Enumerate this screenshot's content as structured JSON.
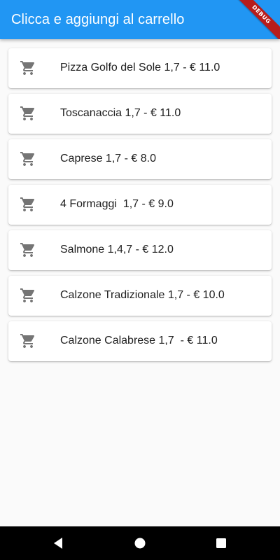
{
  "appbar": {
    "title": "Clicca e aggiungi al carrello",
    "color": "#2196f3"
  },
  "debug_banner": {
    "label": "DEBUG",
    "color": "#b71c1c"
  },
  "items": [
    {
      "label": "Pizza Golfo del Sole 1,7 - € 11.0",
      "icon": "shopping-cart-icon"
    },
    {
      "label": "Toscanaccia 1,7 - € 11.0",
      "icon": "shopping-cart-icon"
    },
    {
      "label": "Caprese 1,7 - € 8.0",
      "icon": "shopping-cart-icon"
    },
    {
      "label": "4 Formaggi  1,7 - € 9.0",
      "icon": "shopping-cart-icon"
    },
    {
      "label": "Salmone 1,4,7 - € 12.0",
      "icon": "shopping-cart-icon"
    },
    {
      "label": "Calzone Tradizionale 1,7 - € 10.0",
      "icon": "shopping-cart-icon"
    },
    {
      "label": "Calzone Calabrese 1,7  - € 11.0",
      "icon": "shopping-cart-icon"
    }
  ],
  "icon_color": "#757575",
  "navbar": {
    "buttons": [
      "back-icon",
      "home-icon",
      "recents-icon"
    ]
  }
}
